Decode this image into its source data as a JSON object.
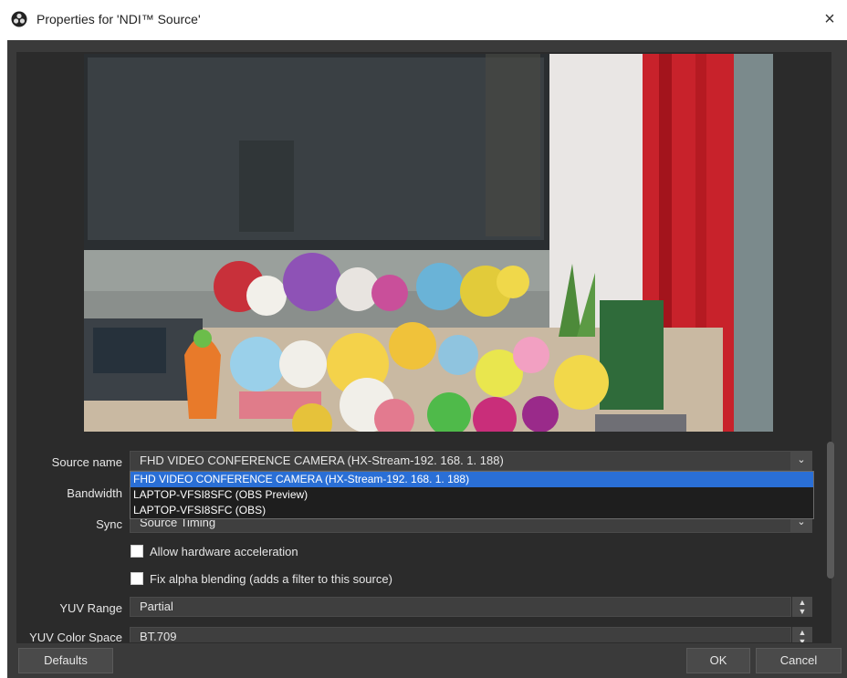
{
  "window": {
    "title": "Properties for 'NDI™ Source'",
    "close_glyph": "×",
    "icon": "obs-logo-icon"
  },
  "preview": {
    "icon": "camera-preview"
  },
  "form": {
    "source_name": {
      "label": "Source name",
      "value": "FHD VIDEO CONFERENCE CAMERA (HX-Stream-192. 168. 1. 188)",
      "options": [
        "FHD VIDEO CONFERENCE CAMERA (HX-Stream-192. 168. 1. 188)",
        "LAPTOP-VFSI8SFC (OBS Preview)",
        "LAPTOP-VFSI8SFC (OBS)"
      ],
      "selected_index": 0
    },
    "bandwidth": {
      "label": "Bandwidth"
    },
    "sync": {
      "label": "Sync",
      "value": "Source Timing"
    },
    "hw_accel": {
      "label": "Allow hardware acceleration",
      "checked": false
    },
    "fix_alpha": {
      "label": "Fix alpha blending (adds a filter to this source)",
      "checked": false
    },
    "yuv_range": {
      "label": "YUV Range",
      "value": "Partial"
    },
    "yuv_color_space": {
      "label": "YUV Color Space",
      "value": "BT.709"
    }
  },
  "buttons": {
    "defaults": "Defaults",
    "ok": "OK",
    "cancel": "Cancel"
  },
  "colors": {
    "panel": "#2b2b2b",
    "frame": "#3a3a3a",
    "selection": "#2a6fd6"
  }
}
